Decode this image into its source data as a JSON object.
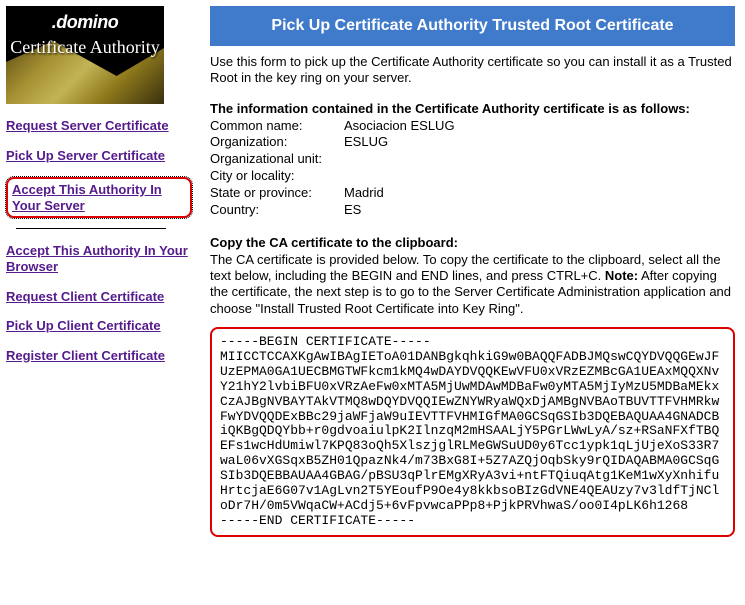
{
  "logo": {
    "brand": ".domino",
    "label": "Certificate\nAuthority"
  },
  "sidebar": {
    "links": [
      {
        "label": "Request Server Certificate"
      },
      {
        "label": "Pick Up Server Certificate"
      },
      {
        "label": "Accept This Authority In Your Server",
        "highlighted": true
      },
      {
        "label": "Accept This Authority In Your Browser"
      },
      {
        "label": "Request Client Certificate"
      },
      {
        "label": "Pick Up Client Certificate"
      },
      {
        "label": "Register Client Certificate"
      }
    ]
  },
  "main": {
    "banner": "Pick Up Certificate Authority Trusted Root Certificate",
    "intro": "Use this form to pick up the Certificate Authority certificate so you can install it as a Trusted Root in the key ring on your server.",
    "info_heading": "The information contained in the Certificate Authority certificate is as follows:",
    "info": {
      "common_name_label": "Common name:",
      "common_name_value": "Asociacion ESLUG",
      "organization_label": "Organization:",
      "organization_value": "ESLUG",
      "org_unit_label": "Organizational unit:",
      "org_unit_value": "",
      "city_label": "City or locality:",
      "city_value": "",
      "state_label": "State or province:",
      "state_value": "Madrid",
      "country_label": "Country:",
      "country_value": "ES"
    },
    "copy_heading": "Copy the CA certificate to the clipboard:",
    "copy_text_1": "The CA certificate is provided below. To copy the certificate to the clipboard, select all the text below, including the BEGIN and END lines, and press CTRL+C. ",
    "copy_note_label": "Note:",
    "copy_text_2": " After copying the certificate, the next step is to go to the Server Certificate Administration application and choose \"Install Trusted Root Certificate into Key Ring\".",
    "certificate": "-----BEGIN CERTIFICATE-----\nMIICCTCCAXKgAwIBAgIEToA01DANBgkqhkiG9w0BAQQFADBJMQswCQYDVQQGEwJF\nUzEPMA0GA1UECBMGTWFkcm1kMQ4wDAYDVQQKEwVFU0xVRzEZMBcGA1UEAxMQQXNv\nY21hY2lvbiBFU0xVRzAeFw0xMTA5MjUwMDAwMDBaFw0yMTA5MjIyMzU5MDBaMEkx\nCzAJBgNVBAYTAkVTMQ8wDQYDVQQIEwZNYWRyaWQxDjAMBgNVBAoTBUVTTFVHMRkw\nFwYDVQQDExBBc29jaWFjaW9uIEVTTFVHMIGfMA0GCSqGSIb3DQEBAQUAA4GNADCB\niQKBgQDQYbb+r0gdvoaiulpK2IlnzqM2mHSAALjY5PGrLWwLyA/sz+RSaNFXfTBQ\nEFs1wcHdUmiwl7KPQ83oQh5XlszjglRLMeGWSuUD0y6Tcc1ypk1qLjUjeXoS33R7\nwaL06vXGSqxB5ZH01QpazNk4/m73BxG8I+5Z7AZQjOqbSky9rQIDAQABMA0GCSqG\nSIb3DQEBBAUAA4GBAG/pBSU3qPlrEMgXRyA3vi+ntFTQiuqAtg1KeM1wXyXnhifu\nHrtcjaE6G07v1AgLvn2T5YEoufP9Oe4y8kkbsoBIzGdVNE4QEAUzy7v3ldfTjNCl\noDr7H/0m5VWqaCW+ACdj5+6vFpvwcaPPp8+PjkPRVhwaS/oo0I4pLK6h1268\n-----END CERTIFICATE-----"
  }
}
